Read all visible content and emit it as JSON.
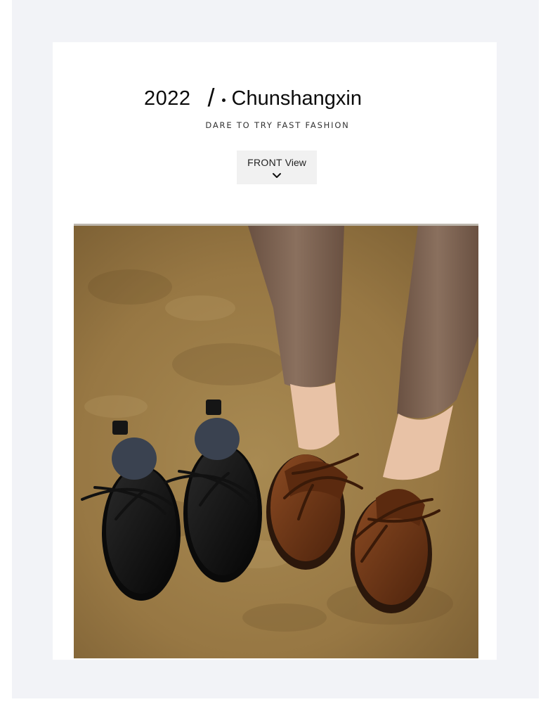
{
  "header": {
    "year": "2022",
    "separator": "/",
    "brand": "Chunshangxin",
    "tagline": "DARE TO TRY FAST FASHION"
  },
  "view_button": {
    "label_strong": "FRONT",
    "label_rest": "View",
    "icon": "chevron-down-icon"
  },
  "photo": {
    "subject": "product-photo",
    "colors": {
      "floor": "#9a7a46",
      "black_shoe": "#141414",
      "brown_shoe": "#6e3414",
      "trousers": "#7a6150"
    }
  }
}
